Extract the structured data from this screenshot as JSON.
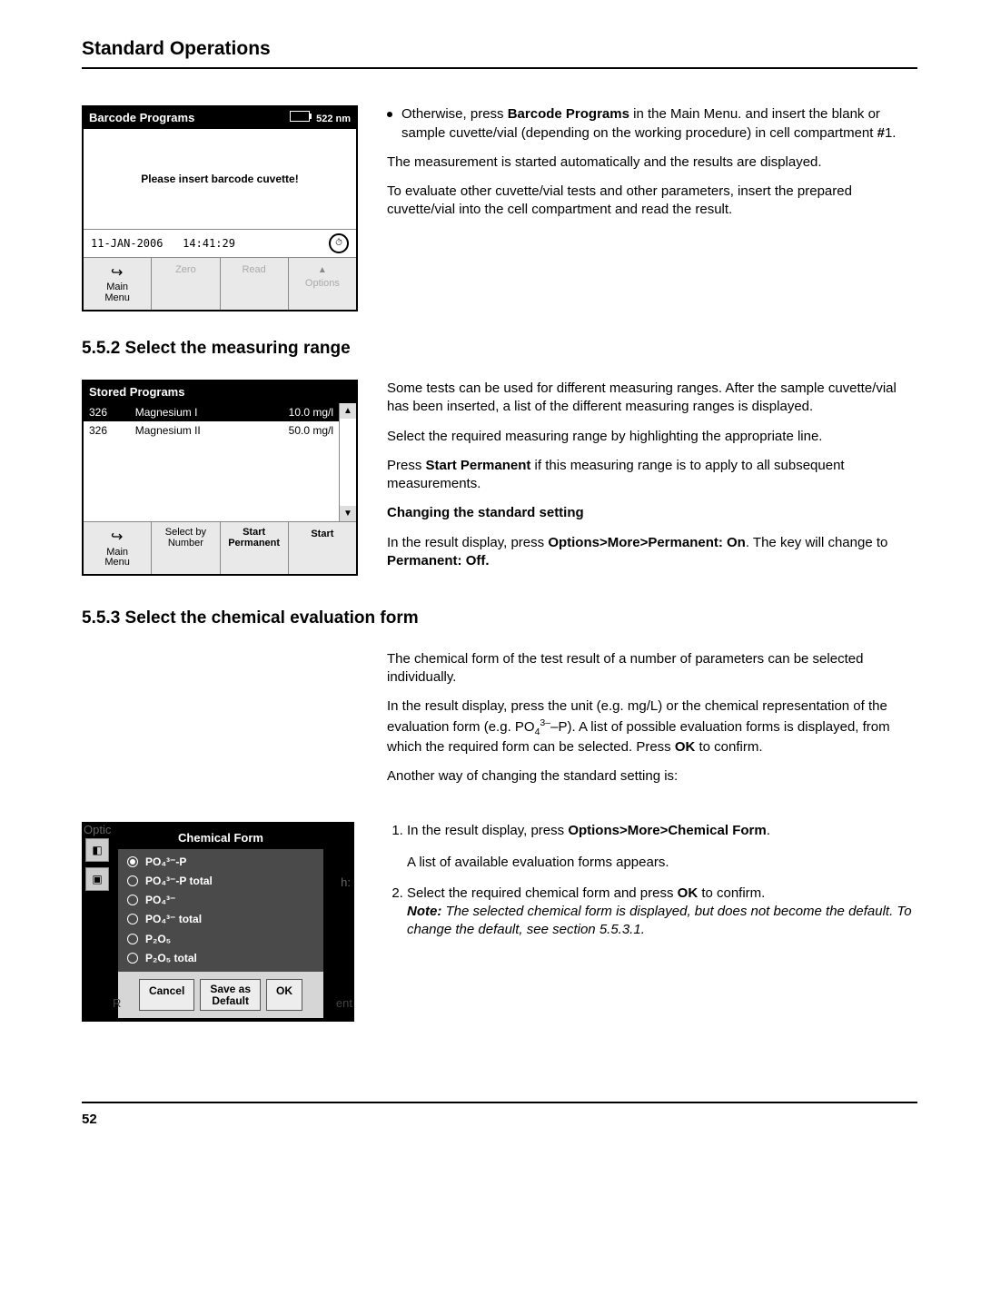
{
  "header": {
    "title": "Standard Operations"
  },
  "footer": {
    "page": "52"
  },
  "barcode_screen": {
    "title": "Barcode Programs",
    "wavelength": "522 nm",
    "message": "Please insert barcode cuvette!",
    "date": "11-JAN-2006",
    "time": "14:41:29",
    "buttons": {
      "main_menu_l1": "Main",
      "main_menu_l2": "Menu",
      "zero": "Zero",
      "read": "Read",
      "options": "Options"
    }
  },
  "barcode_text": {
    "bullet_line1": "Otherwise, press ",
    "bullet_bold": "Barcode Programs",
    "bullet_line1b": " in the Main Menu. and insert the blank or sample cuvette/vial (depending on the working procedure) in cell compartment ",
    "bullet_bold2": "#",
    "bullet_line1c": "1.",
    "p1": "The measurement is started automatically and the results are displayed.",
    "p2": "To evaluate other cuvette/vial tests and other parameters, insert the prepared cuvette/vial into the cell compartment and read the result."
  },
  "sec552": {
    "heading": "5.5.2  Select the measuring range"
  },
  "stored_screen": {
    "title": "Stored Programs",
    "rows": [
      {
        "num": "326",
        "name": "Magnesium I",
        "val": "10.0 mg/l",
        "selected": true
      },
      {
        "num": "326",
        "name": "Magnesium II",
        "val": "50.0 mg/l",
        "selected": false
      }
    ],
    "buttons": {
      "main_menu_l1": "Main",
      "main_menu_l2": "Menu",
      "selby_l1": "Select by",
      "selby_l2": "Number",
      "startperm_l1": "Start",
      "startperm_l2": "Permanent",
      "start": "Start"
    }
  },
  "sec552_text": {
    "p1": "Some tests can be used for different measuring ranges. After the sample cuvette/vial has been inserted, a list of the different measuring ranges is displayed.",
    "p2": "Select the required measuring range by highlighting the appropriate line.",
    "p3a": "Press ",
    "p3b": "Start Permanent",
    "p3c": " if this measuring range is to apply to all subsequent measurements.",
    "sub": "Changing the standard setting",
    "p4a": "In the result display, press ",
    "p4b": "Options>More>Permanent: On",
    "p4c": ". The key will change to ",
    "p4d": "Permanent: Off."
  },
  "sec553": {
    "heading": "5.5.3  Select the chemical evaluation form"
  },
  "sec553_text": {
    "p1": "The chemical form of the test result of a number of parameters can be selected individually.",
    "p2a": "In the result display, press the unit (e.g. mg/L) or the chemical representation of the evaluation form (e.g. PO",
    "p2_sub1": "4",
    "p2_sup1": "3–",
    "p2b": "–P). A list of possible evaluation forms is displayed, from which the required form can be selected. Press ",
    "p2_ok": "OK",
    "p2c": " to confirm.",
    "p3": "Another way of changing the standard setting is:"
  },
  "chem_dialog": {
    "corner": "Optic",
    "title": "Chemical Form",
    "options": [
      "PO₄³⁻-P",
      "PO₄³⁻-P total",
      "PO₄³⁻",
      "PO₄³⁻ total",
      "P₂O₅",
      "P₂O₅ total"
    ],
    "cancel": "Cancel",
    "save_l1": "Save as",
    "save_l2": "Default",
    "ok": "OK",
    "cut_right": "h:",
    "cut_br": "ent",
    "cut_bl": "R"
  },
  "sec553_steps": {
    "s1a": "In the result display, press ",
    "s1b": "Options>More>Chemical Form",
    "s1c": ".",
    "s1d": "A list of available evaluation forms appears.",
    "s2a": "Select the required chemical form and press ",
    "s2b": "OK",
    "s2c": " to confirm.",
    "note_lead": "Note:",
    "note": " The selected chemical form is displayed, but does not become the default. To change the default, see section 5.5.3.1."
  }
}
